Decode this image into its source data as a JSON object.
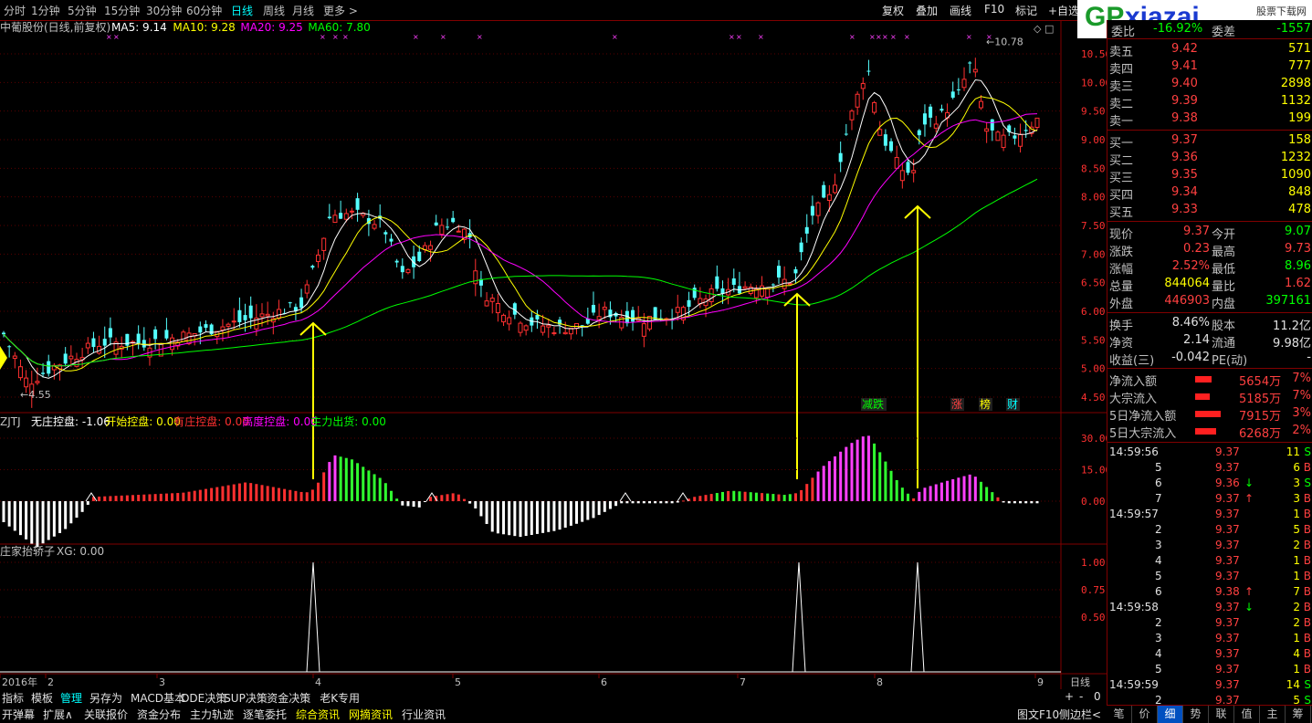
{
  "toolbar": {
    "periods": [
      "分时",
      "1分钟",
      "5分钟",
      "15分钟",
      "30分钟",
      "60分钟",
      "日线",
      "周线",
      "月线",
      "更多 >"
    ],
    "active_period": "日线",
    "right_buttons": [
      "复权",
      "叠加",
      "画线",
      "F10",
      "标记",
      "+自选",
      "返"
    ]
  },
  "watermark": {
    "gp": "GP",
    "xiazai": "xiazai",
    "dotcom": ".com",
    "sub": "股票下载网"
  },
  "main_chart": {
    "title": "中葡股份(日线,前复权)",
    "ma_labels": [
      {
        "text": "MA5: 9.14",
        "color": "#ffffff"
      },
      {
        "text": "MA10: 9.28",
        "color": "#ffff00"
      },
      {
        "text": "MA20: 9.25",
        "color": "#ff00ff"
      },
      {
        "text": "MA60: 7.80",
        "color": "#00ff00"
      }
    ],
    "y_ticks": [
      "10.50",
      "10.00",
      "9.50",
      "9.00",
      "8.50",
      "8.00",
      "7.50",
      "7.00",
      "6.50",
      "6.00",
      "5.50",
      "5.00",
      "4.50"
    ],
    "high_label": "10.78",
    "low_label": "4.55",
    "tags": [
      {
        "text": "减跌",
        "color": "#00ff00"
      },
      {
        "text": "涨",
        "color": "#ff4040"
      },
      {
        "text": "榜",
        "color": "#ffff00"
      },
      {
        "text": "财",
        "color": "#00ffff"
      }
    ]
  },
  "ind1": {
    "name": "ZJTJ",
    "labels": [
      {
        "text": "无庄控盘: -1.06",
        "color": "#ffffff"
      },
      {
        "text": "开始控盘: 0.00",
        "color": "#ffff00"
      },
      {
        "text": "有庄控盘: 0.00",
        "color": "#ff3030"
      },
      {
        "text": "高度控盘: 0.00",
        "color": "#ff00ff"
      },
      {
        "text": "主力出货: 0.00",
        "color": "#00ff00"
      }
    ],
    "y_ticks": [
      "30.00",
      "15.00",
      "0.00"
    ]
  },
  "ind2": {
    "name": "庄家抬轿子",
    "label": "XG: 0.00",
    "y_ticks": [
      "1.00",
      "0.75",
      "0.50"
    ]
  },
  "x_axis": {
    "labels": [
      "2016年",
      "2",
      "3",
      "4",
      "5",
      "6",
      "7",
      "8",
      "9"
    ],
    "period": "日线"
  },
  "quote": {
    "header_left": "委比",
    "header_left_val": "-16.92%",
    "header_right": "委差",
    "header_right_val": "-1557",
    "asks": [
      {
        "label": "卖五",
        "price": "9.42",
        "vol": "571"
      },
      {
        "label": "卖四",
        "price": "9.41",
        "vol": "777"
      },
      {
        "label": "卖三",
        "price": "9.40",
        "vol": "2898"
      },
      {
        "label": "卖二",
        "price": "9.39",
        "vol": "1132"
      },
      {
        "label": "卖一",
        "price": "9.38",
        "vol": "199"
      }
    ],
    "bids": [
      {
        "label": "买一",
        "price": "9.37",
        "vol": "158"
      },
      {
        "label": "买二",
        "price": "9.36",
        "vol": "1232"
      },
      {
        "label": "买三",
        "price": "9.35",
        "vol": "1090"
      },
      {
        "label": "买四",
        "price": "9.34",
        "vol": "848"
      },
      {
        "label": "买五",
        "price": "9.33",
        "vol": "478"
      }
    ],
    "stats": [
      {
        "l1": "现价",
        "v1": "9.37",
        "c1": "#ff4040",
        "l2": "今开",
        "v2": "9.07",
        "c2": "#00ff00"
      },
      {
        "l1": "涨跌",
        "v1": "0.23",
        "c1": "#ff4040",
        "l2": "最高",
        "v2": "9.73",
        "c2": "#ff4040"
      },
      {
        "l1": "涨幅",
        "v1": "2.52%",
        "c1": "#ff4040",
        "l2": "最低",
        "v2": "8.96",
        "c2": "#00ff00"
      },
      {
        "l1": "总量",
        "v1": "844064",
        "c1": "#ffff00",
        "l2": "量比",
        "v2": "1.62",
        "c2": "#ff4040"
      },
      {
        "l1": "外盘",
        "v1": "446903",
        "c1": "#ff4040",
        "l2": "内盘",
        "v2": "397161",
        "c2": "#00ff00"
      }
    ],
    "stats2": [
      {
        "l1": "换手",
        "v1": "8.46%",
        "l2": "股本",
        "v2": "11.2亿"
      },
      {
        "l1": "净资",
        "v1": "2.14",
        "l2": "流通",
        "v2": "9.98亿"
      },
      {
        "l1": "收益(三)",
        "v1": "-0.042",
        "l2": "PE(动)",
        "v2": "-"
      }
    ],
    "flows": [
      {
        "label": "净流入额",
        "value": "5654万",
        "pct": "7%",
        "bar": 0.35
      },
      {
        "label": "大宗流入",
        "value": "5185万",
        "pct": "7%",
        "bar": 0.32
      },
      {
        "label": "5日净流入额",
        "value": "7915万",
        "pct": "3%",
        "bar": 0.55
      },
      {
        "label": "5日大宗流入",
        "value": "6268万",
        "pct": "2%",
        "bar": 0.45
      }
    ],
    "ticks": [
      {
        "t": "14:59:56",
        "p": "9.37",
        "v": "11",
        "s": "S",
        "arrow": ""
      },
      {
        "t": "5",
        "p": "9.37",
        "v": "6",
        "s": "B",
        "arrow": ""
      },
      {
        "t": "6",
        "p": "9.36",
        "v": "3",
        "s": "S",
        "arrow": "↓"
      },
      {
        "t": "7",
        "p": "9.37",
        "v": "3",
        "s": "B",
        "arrow": "↑"
      },
      {
        "t": "14:59:57",
        "p": "9.37",
        "v": "1",
        "s": "B",
        "arrow": ""
      },
      {
        "t": "2",
        "p": "9.37",
        "v": "5",
        "s": "B",
        "arrow": ""
      },
      {
        "t": "3",
        "p": "9.37",
        "v": "2",
        "s": "B",
        "arrow": ""
      },
      {
        "t": "4",
        "p": "9.37",
        "v": "1",
        "s": "B",
        "arrow": ""
      },
      {
        "t": "5",
        "p": "9.37",
        "v": "1",
        "s": "B",
        "arrow": ""
      },
      {
        "t": "6",
        "p": "9.38",
        "v": "7",
        "s": "B",
        "arrow": "↑"
      },
      {
        "t": "14:59:58",
        "p": "9.37",
        "v": "2",
        "s": "B",
        "arrow": "↓"
      },
      {
        "t": "2",
        "p": "9.37",
        "v": "2",
        "s": "B",
        "arrow": ""
      },
      {
        "t": "3",
        "p": "9.37",
        "v": "1",
        "s": "B",
        "arrow": ""
      },
      {
        "t": "4",
        "p": "9.37",
        "v": "4",
        "s": "B",
        "arrow": ""
      },
      {
        "t": "5",
        "p": "9.37",
        "v": "1",
        "s": "B",
        "arrow": ""
      },
      {
        "t": "14:59:59",
        "p": "9.37",
        "v": "14",
        "s": "S",
        "arrow": ""
      },
      {
        "t": "2",
        "p": "9.37",
        "v": "5",
        "s": "S",
        "arrow": ""
      }
    ]
  },
  "bottom": {
    "row1": [
      "指标",
      "模板",
      "管理",
      "另存为",
      "MACD基本",
      "DDE决策",
      "SUP决策",
      "资金决策",
      "老K专用"
    ],
    "row1_active": "管理",
    "row2": [
      "开弹幕",
      "扩展∧",
      "关联报价",
      "资金分布",
      "主力轨迹",
      "逐笔委托",
      "综合资讯",
      "网摘资讯",
      "行业资讯"
    ],
    "right_labels": [
      "图文F10",
      "侧边栏<"
    ],
    "side_tabs": [
      "笔",
      "价",
      "细",
      "势",
      "联",
      "值",
      "主",
      "筹"
    ],
    "side_active": "细"
  }
}
